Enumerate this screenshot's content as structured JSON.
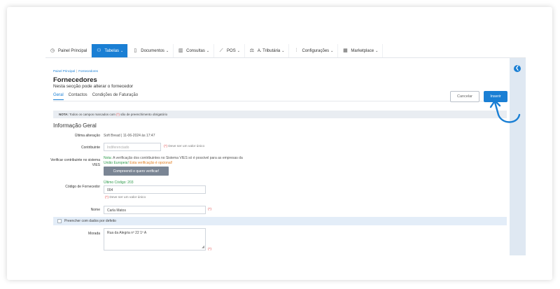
{
  "nav": {
    "items": [
      {
        "label": "Painel Principal",
        "icon": "clock-icon",
        "has_menu": false
      },
      {
        "label": "Tabelas",
        "icon": "people-icon",
        "has_menu": true
      },
      {
        "label": "Documentos",
        "icon": "document-icon",
        "has_menu": true
      },
      {
        "label": "Consultas",
        "icon": "bar-chart-icon",
        "has_menu": true
      },
      {
        "label": "POS",
        "icon": "pos-icon",
        "has_menu": true
      },
      {
        "label": "A. Tributária",
        "icon": "scale-icon",
        "has_menu": true
      },
      {
        "label": "Configurações",
        "icon": "sliders-icon",
        "has_menu": true
      },
      {
        "label": "Marketplace",
        "icon": "grid-icon",
        "has_menu": true
      }
    ],
    "active_index": 1
  },
  "breadcrumb": {
    "home": "Painel Principal",
    "separator": "|",
    "current": "Fornecedores"
  },
  "page": {
    "title": "Fornecedores",
    "subtitle": "Nesta secção pode alterar o fornecedor"
  },
  "tabs": [
    "Geral",
    "Contactos",
    "Condições de Faturação"
  ],
  "buttons": {
    "cancel": "Cancelar",
    "insert": "Inserir"
  },
  "note": {
    "prefix": "NOTA:",
    "text_before": " Todos os campos marcados com ",
    "mark": "(*)",
    "text_after": " são de preenchimento obrigatório"
  },
  "section_title": "Informação Geral",
  "fields": {
    "last_change_label": "Última alteração",
    "last_change_value": "Soft Bread | 11-06-2024 às 17:47",
    "contribuinte_label": "Contribuinte",
    "contribuinte_placeholder": "Indiferenciado",
    "req_mark": "(*)",
    "unique_msg": " Deve ser um valor único",
    "vies_label": "Verificar contribuinte no sistema VIES",
    "vies_note_prefix": "Nota:",
    "vies_note_text": " A verificação dos contribuintes no Sistema VIES só é possível para as empresas da",
    "vies_note_line2": "União Europeia!",
    "vies_note_orange": " Esta verificação é opcional!",
    "vies_button": "Compreendi e quero verificar!",
    "code_label": "Código de Fornecedor",
    "last_code": "Último Código: 203",
    "code_value": "004",
    "name_label": "Nome",
    "name_value": "Carla Matos",
    "prefill_label": "Preencher com dados por defeito",
    "address_label": "Morada",
    "address_value": "Rua da Alegria nº 22 1º A"
  },
  "colors": {
    "accent": "#1a7fd4",
    "required": "#e04343",
    "success": "#2e9a4b",
    "warning": "#e07b1c"
  }
}
